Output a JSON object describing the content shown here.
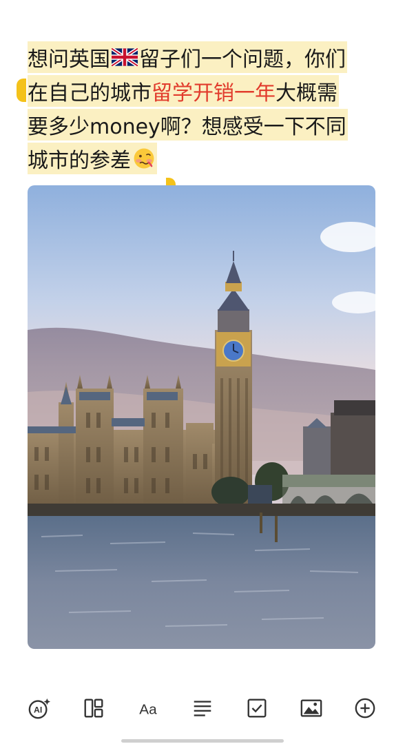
{
  "note": {
    "lines": [
      {
        "segments": [
          {
            "text": "想问英国",
            "style": "normal"
          },
          {
            "flag": "uk-flag-icon"
          },
          {
            "text": "留子们一个问题，你们",
            "style": "normal"
          }
        ]
      },
      {
        "segments": [
          {
            "text": "在自己的城市",
            "style": "normal"
          },
          {
            "text": "留学开销一年",
            "style": "red"
          },
          {
            "text": "大概需",
            "style": "normal"
          }
        ]
      },
      {
        "segments": [
          {
            "text": "要多少money啊？想感受一下不同",
            "style": "normal"
          }
        ]
      },
      {
        "segments": [
          {
            "text": "城市的参差",
            "style": "normal"
          },
          {
            "emoji": "woozy-face-icon"
          }
        ]
      }
    ],
    "highlight_color": "#fbf0c2",
    "emphasis_color": "#e13b2c"
  },
  "photo": {
    "subject": "big-ben-westminster-photo"
  },
  "toolbar": {
    "items": [
      {
        "name": "ai-assistant-icon",
        "label": "AI"
      },
      {
        "name": "layout-icon"
      },
      {
        "name": "text-format-icon",
        "label": "Aa"
      },
      {
        "name": "paragraph-icon"
      },
      {
        "name": "checkbox-icon"
      },
      {
        "name": "image-icon"
      },
      {
        "name": "add-icon"
      }
    ]
  },
  "colors": {
    "handle": "#f4c21a",
    "icon": "#333333"
  }
}
